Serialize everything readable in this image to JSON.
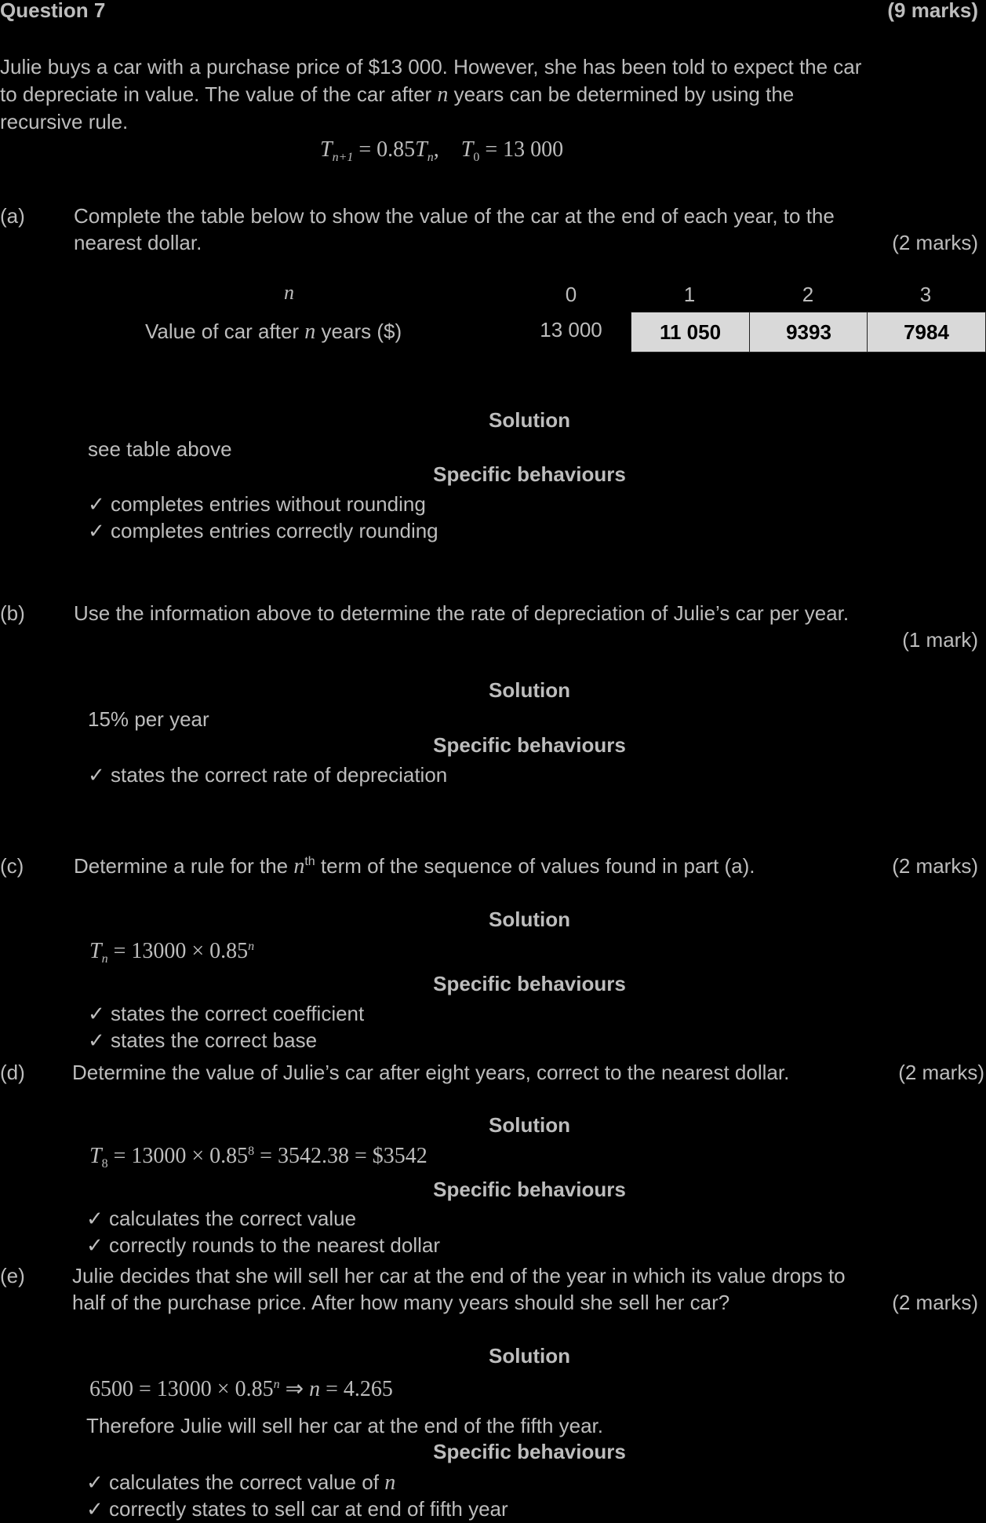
{
  "question": {
    "title": "Question 7",
    "marks": "(9 marks)",
    "intro_line1": "Julie buys a car with a purchase price of $13 000. However, she has been told to expect the car",
    "intro_line2_a": "to depreciate in value. The value of the car after ",
    "intro_line2_n": "n",
    "intro_line2_b": " years can be determined by using the",
    "intro_line3": "recursive rule.",
    "rule": {
      "lhs_T": "T",
      "lhs_sub": "n+1",
      "eq1": " = 0.85",
      "rhs_T": "T",
      "rhs_sub": "n",
      "sep": ",",
      "t0_T": "T",
      "t0_sub": "0",
      "t0_val": " = 13 000"
    }
  },
  "part_a": {
    "label": "(a)",
    "line1": "Complete the table below to show the value of the car at the end of each year, to the",
    "line2": "nearest dollar.",
    "marks": "(2 marks)",
    "table": {
      "row1_label": "n",
      "row2_label_a": "Value of car after ",
      "row2_label_n": "n",
      "row2_label_b": " years ($)",
      "headers": [
        "0",
        "1",
        "2",
        "3"
      ],
      "values": [
        "13 000",
        "11 050",
        "9393",
        "7984"
      ]
    },
    "solution_title": "Solution",
    "solution": "see table above",
    "sb_title": "Specific behaviours",
    "behaviours": [
      "✓ completes entries without rounding",
      "✓ completes entries correctly rounding"
    ]
  },
  "part_b": {
    "label": "(b)",
    "line1": "Use the information above to determine the rate of depreciation of Julie’s car per year.",
    "marks": "(1 mark)",
    "solution_title": "Solution",
    "solution": "15% per year",
    "sb_title": "Specific behaviours",
    "behaviours": [
      "✓ states the correct rate of depreciation"
    ]
  },
  "part_c": {
    "label": "(c)",
    "line_a": "Determine a rule for the ",
    "line_n": "n",
    "line_th": "th",
    "line_b": " term of the sequence of values found in part (a).",
    "marks": "(2 marks)",
    "solution_title": "Solution",
    "sol_T": "T",
    "sol_sub": "n",
    "sol_expr": " = 13000 × 0.85",
    "sol_sup": "n",
    "sb_title": "Specific behaviours",
    "behaviours": [
      "✓ states the correct coefficient",
      "✓ states the correct base"
    ]
  },
  "part_d": {
    "label": "(d)",
    "line1": "Determine the value of Julie’s car after eight years, correct to the nearest dollar.",
    "marks": "(2 marks)",
    "solution_title": "Solution",
    "sol_T": "T",
    "sol_sub": "8",
    "sol_expr": " = 13000 × 0.85",
    "sol_sup": "8",
    "sol_tail": " = 3542.38 = $3542",
    "sb_title": "Specific behaviours",
    "behaviours": [
      "✓ calculates the correct value",
      "✓ correctly rounds to the nearest dollar"
    ]
  },
  "part_e": {
    "label": "(e)",
    "line1": "Julie decides that she will sell her car at the end of the year in which its value drops to",
    "line2": "half of the purchase price. After how many years should she sell her car?",
    "marks": "(2 marks)",
    "solution_title": "Solution",
    "sol_expr": "6500 = 13000 × 0.85",
    "sol_sup": "n",
    "sol_arrow": " ⇒ ",
    "sol_n": "n",
    "sol_val": " = 4.265",
    "sol_line2": "Therefore Julie will sell her car at the end of the fifth year.",
    "sb_title": "Specific behaviours",
    "behaviour1_a": "✓ calculates the correct value of ",
    "behaviour1_n": "n",
    "behaviour2": "✓ correctly states to sell car at end of fifth year"
  }
}
